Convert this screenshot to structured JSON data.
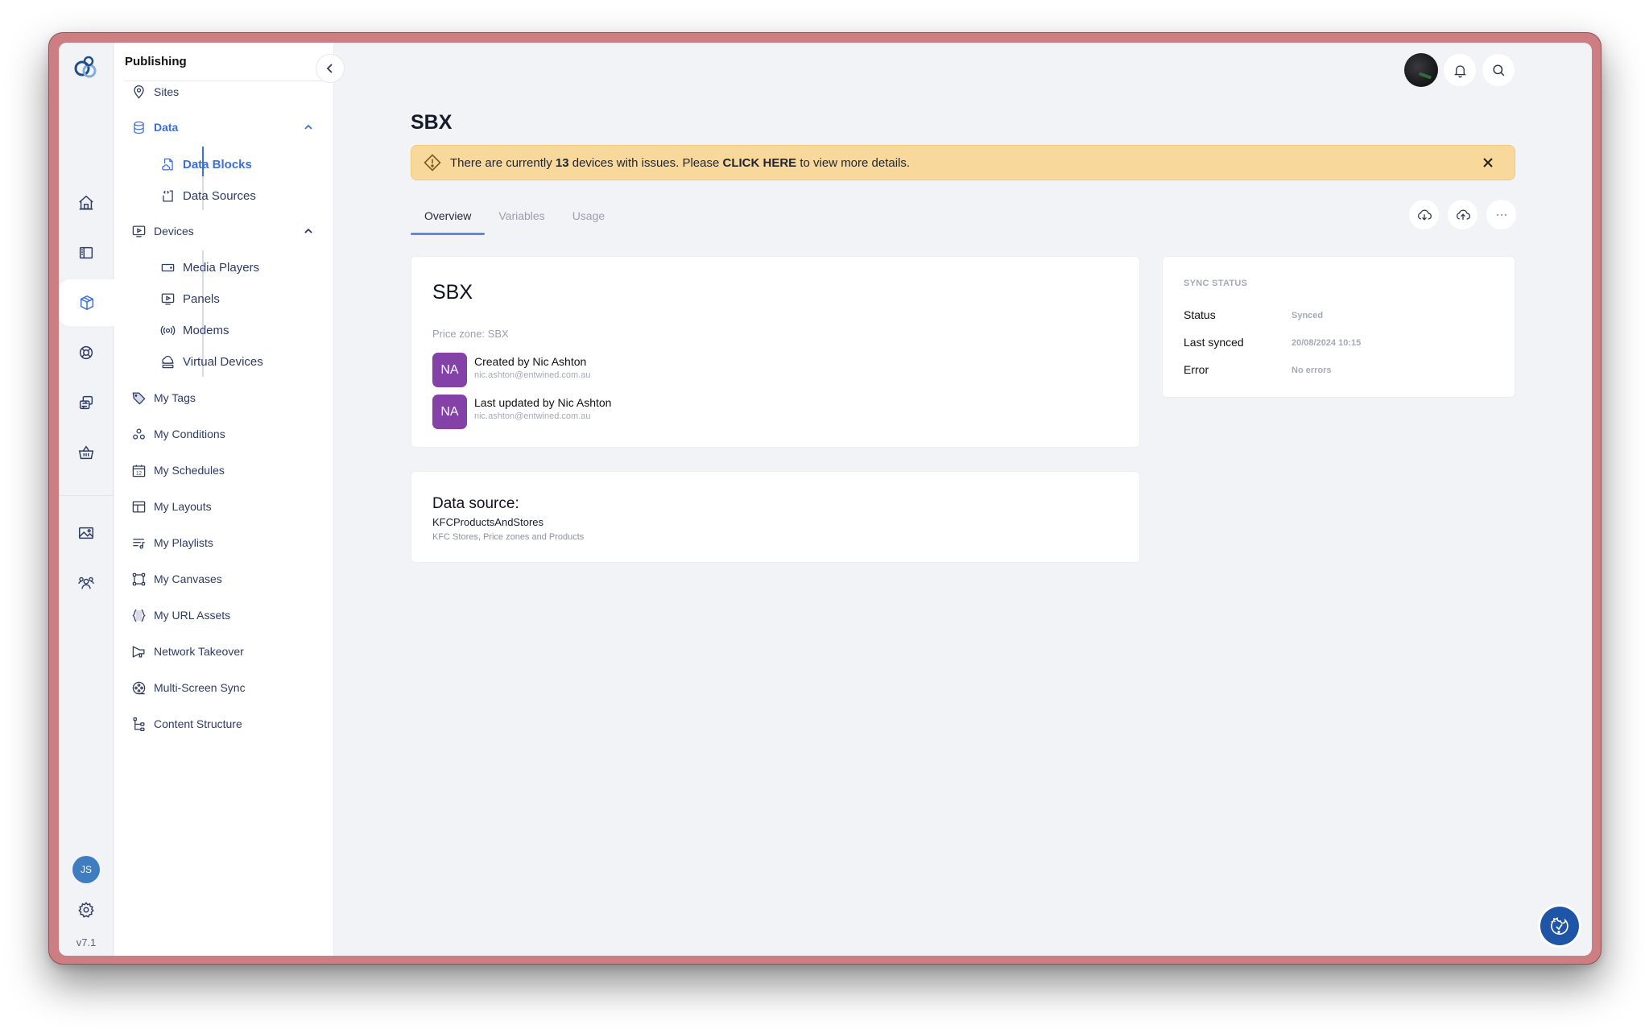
{
  "app": {
    "section_title": "Publishing",
    "version": "v7.1",
    "user_initials": "JS"
  },
  "rail": {
    "items": [
      {
        "name": "home",
        "icon": "home-icon"
      },
      {
        "name": "sidebar",
        "icon": "sidebar-panel-icon"
      },
      {
        "name": "publishing",
        "icon": "cube-icon",
        "active": true
      },
      {
        "name": "support",
        "icon": "lifebuoy-icon"
      },
      {
        "name": "sync",
        "icon": "swap-icon"
      },
      {
        "name": "store",
        "icon": "basket-icon"
      },
      {
        "name": "media",
        "icon": "image-icon"
      },
      {
        "name": "users",
        "icon": "users-icon"
      }
    ]
  },
  "nav": {
    "sites": "Sites",
    "data": "Data",
    "data_blocks": "Data Blocks",
    "data_sources": "Data Sources",
    "devices": "Devices",
    "media_players": "Media Players",
    "panels": "Panels",
    "modems": "Modems",
    "virtual_devices": "Virtual Devices",
    "my_tags": "My Tags",
    "my_conditions": "My Conditions",
    "my_schedules": "My Schedules",
    "my_layouts": "My Layouts",
    "my_playlists": "My Playlists",
    "my_canvases": "My Canvases",
    "my_url_assets": "My URL Assets",
    "network_takeover": "Network Takeover",
    "multi_screen_sync": "Multi-Screen Sync",
    "content_structure": "Content Structure",
    "schedule_icon_day": "12"
  },
  "page": {
    "title": "SBX",
    "alert": {
      "prefix": "There are currently ",
      "count": "13",
      "middle": " devices with issues. Please ",
      "link": "CLICK HERE",
      "suffix": " to view more details."
    },
    "tabs": [
      {
        "label": "Overview",
        "active": true
      },
      {
        "label": "Variables"
      },
      {
        "label": "Usage"
      }
    ]
  },
  "detail": {
    "title": "SBX",
    "price_zone": "Price zone: SBX",
    "created": {
      "initials": "NA",
      "label": "Created by Nic Ashton",
      "email": "nic.ashton@entwined.com.au"
    },
    "updated": {
      "initials": "NA",
      "label": "Last updated by Nic Ashton",
      "email": "nic.ashton@entwined.com.au"
    }
  },
  "data_source": {
    "heading": "Data source:",
    "name": "KFCProductsAndStores",
    "description": "KFC Stores, Price zones and Products"
  },
  "sync": {
    "heading": "SYNC STATUS",
    "rows": [
      {
        "key": "Status",
        "value": "Synced"
      },
      {
        "key": "Last synced",
        "value": "20/08/2024 10:15"
      },
      {
        "key": "Error",
        "value": "No errors"
      }
    ]
  },
  "colors": {
    "accent": "#3b6fe0",
    "alert_bg": "#f8d99b",
    "avatar": "#8442a8",
    "cookie_btn": "#1f55a6"
  }
}
